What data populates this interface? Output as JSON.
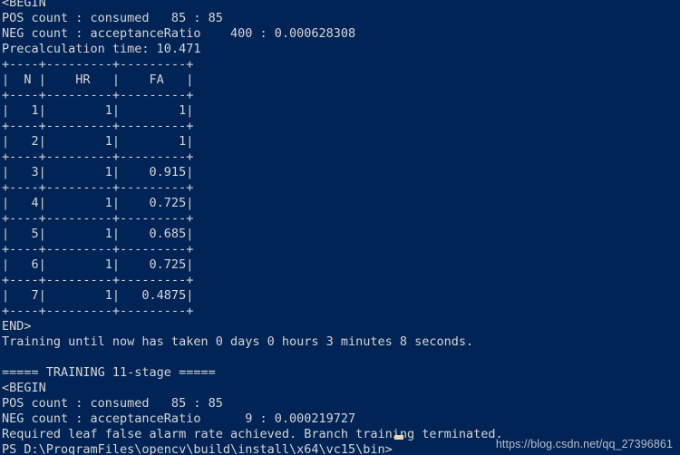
{
  "terminal": {
    "background_color": "#012456",
    "text_color": "#d6d6d6",
    "cursor_color": "#e8d7b0",
    "console_text": "<BEGIN\nPOS count : consumed   85 : 85\nNEG count : acceptanceRatio    400 : 0.000628308\nPrecalculation time: 10.471\n+----+---------+---------+\n|  N |    HR   |    FA   |\n+----+---------+---------+\n|   1|        1|        1|\n+----+---------+---------+\n|   2|        1|        1|\n+----+---------+---------+\n|   3|        1|    0.915|\n+----+---------+---------+\n|   4|        1|    0.725|\n+----+---------+---------+\n|   5|        1|    0.685|\n+----+---------+---------+\n|   6|        1|    0.725|\n+----+---------+---------+\n|   7|        1|   0.4875|\n+----+---------+---------+\nEND>\nTraining until now has taken 0 days 0 hours 3 minutes 8 seconds.\n\n===== TRAINING 11-stage =====\n<BEGIN\nPOS count : consumed   85 : 85\nNEG count : acceptanceRatio      9 : 0.000219727\nRequired leaf false alarm rate achieved. Branch training terminated.\nPS D:\\ProgramFiles\\opencv\\build\\install\\x64\\vc15\\bin>",
    "lines": {
      "begin_marker_1": "<BEGIN",
      "pos_count_1": "POS count : consumed   85 : 85",
      "neg_count_1": "NEG count : acceptanceRatio    400 : 0.000628308",
      "precalculation_time": "Precalculation time: 10.471",
      "end_marker": "END>",
      "training_elapsed": "Training until now has taken 0 days 0 hours 3 minutes 8 seconds.",
      "stage_header": "===== TRAINING 11-stage =====",
      "begin_marker_2": "<BEGIN",
      "pos_count_2": "POS count : consumed   85 : 85",
      "neg_count_2": "NEG count : acceptanceRatio      9 : 0.000219727",
      "termination_message": "Required leaf false alarm rate achieved. Branch training terminated.",
      "prompt": "PS D:\\ProgramFiles\\opencv\\build\\install\\x64\\vc15\\bin>"
    },
    "stage_table": {
      "columns": [
        "N",
        "HR",
        "FA"
      ],
      "separator": "+----+---------+---------+",
      "rows": [
        {
          "N": "1",
          "HR": "1",
          "FA": "1"
        },
        {
          "N": "2",
          "HR": "1",
          "FA": "1"
        },
        {
          "N": "3",
          "HR": "1",
          "FA": "0.915"
        },
        {
          "N": "4",
          "HR": "1",
          "FA": "0.725"
        },
        {
          "N": "5",
          "HR": "1",
          "FA": "0.685"
        },
        {
          "N": "6",
          "HR": "1",
          "FA": "0.725"
        },
        {
          "N": "7",
          "HR": "1",
          "FA": "0.4875"
        }
      ]
    },
    "stats": {
      "pos_consumed_1": "85 : 85",
      "neg_acceptance_1": "400 : 0.000628308",
      "precalculation_seconds": "10.471",
      "elapsed_days": "0",
      "elapsed_hours": "0",
      "elapsed_minutes": "3",
      "elapsed_seconds": "8",
      "stage_number": "11",
      "pos_consumed_2": "85 : 85",
      "neg_acceptance_2": "9 : 0.000219727"
    }
  },
  "watermark": {
    "text": "https://blog.csdn.net/qq_27396861"
  }
}
